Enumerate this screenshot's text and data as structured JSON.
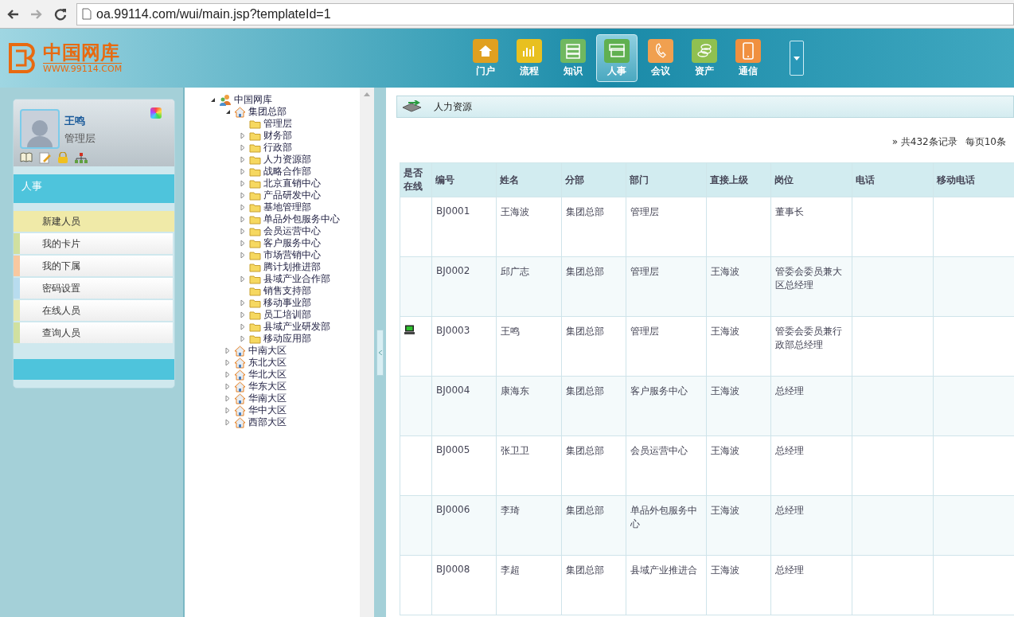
{
  "browser": {
    "url": "oa.99114.com/wui/main.jsp?templateId=1"
  },
  "header": {
    "logo_title": "中国网库",
    "logo_sub": "WWW.99114.COM",
    "nav": [
      {
        "label": "门户",
        "selected": false,
        "color": "#e0a020",
        "kind": "home"
      },
      {
        "label": "流程",
        "selected": false,
        "color": "#e8c020",
        "kind": "chart"
      },
      {
        "label": "知识",
        "selected": false,
        "color": "#70b860",
        "kind": "stack"
      },
      {
        "label": "人事",
        "selected": true,
        "color": "#60b050",
        "kind": "cards"
      },
      {
        "label": "会议",
        "selected": false,
        "color": "#f0a050",
        "kind": "phone"
      },
      {
        "label": "资产",
        "selected": false,
        "color": "#90c050",
        "kind": "coins"
      },
      {
        "label": "通信",
        "selected": false,
        "color": "#f09040",
        "kind": "mobile"
      }
    ]
  },
  "user": {
    "name": "王鸣",
    "role": "管理层"
  },
  "sidebar": {
    "title": "人事",
    "items": [
      {
        "label": "新建人员",
        "selected": true,
        "color": "#f0eaa8"
      },
      {
        "label": "我的卡片",
        "selected": false,
        "color": "#d0e0a0"
      },
      {
        "label": "我的下属",
        "selected": false,
        "color": "#f8c8a0"
      },
      {
        "label": "密码设置",
        "selected": false,
        "color": "#b8dcef"
      },
      {
        "label": "在线人员",
        "selected": false,
        "color": "#e4e8b0"
      },
      {
        "label": "查询人员",
        "selected": false,
        "color": "#d0e0a0"
      }
    ]
  },
  "tree": [
    {
      "label": "中国网库",
      "kind": "root",
      "expanded": true,
      "children": [
        {
          "label": "集团总部",
          "kind": "house",
          "expanded": true,
          "children": [
            {
              "label": "管理层",
              "kind": "folder",
              "has_children": false,
              "expanded": false
            },
            {
              "label": "财务部",
              "kind": "folder",
              "has_children": true,
              "expanded": false
            },
            {
              "label": "行政部",
              "kind": "folder",
              "has_children": true,
              "expanded": false
            },
            {
              "label": "人力资源部",
              "kind": "folder",
              "has_children": true,
              "expanded": false
            },
            {
              "label": "战略合作部",
              "kind": "folder",
              "has_children": true,
              "expanded": false
            },
            {
              "label": "北京直销中心",
              "kind": "folder",
              "has_children": true,
              "expanded": false
            },
            {
              "label": "产品研发中心",
              "kind": "folder",
              "has_children": true,
              "expanded": false
            },
            {
              "label": "基地管理部",
              "kind": "folder",
              "has_children": true,
              "expanded": false
            },
            {
              "label": "单品外包服务中心",
              "kind": "folder",
              "has_children": true,
              "expanded": false
            },
            {
              "label": "会员运营中心",
              "kind": "folder",
              "has_children": true,
              "expanded": false
            },
            {
              "label": "客户服务中心",
              "kind": "folder",
              "has_children": true,
              "expanded": false
            },
            {
              "label": "市场营销中心",
              "kind": "folder",
              "has_children": true,
              "expanded": false
            },
            {
              "label": "腾计划推进部",
              "kind": "folder",
              "has_children": false,
              "expanded": false
            },
            {
              "label": "县域产业合作部",
              "kind": "folder",
              "has_children": true,
              "expanded": false
            },
            {
              "label": "销售支持部",
              "kind": "folder",
              "has_children": false,
              "expanded": false
            },
            {
              "label": "移动事业部",
              "kind": "folder",
              "has_children": true,
              "expanded": false
            },
            {
              "label": "员工培训部",
              "kind": "folder",
              "has_children": true,
              "expanded": false
            },
            {
              "label": "县域产业研发部",
              "kind": "folder",
              "has_children": true,
              "expanded": false
            },
            {
              "label": "移动应用部",
              "kind": "folder",
              "has_children": true,
              "expanded": false
            }
          ]
        },
        {
          "label": "中南大区",
          "kind": "house",
          "has_children": true,
          "expanded": false
        },
        {
          "label": "东北大区",
          "kind": "house",
          "has_children": true,
          "expanded": false
        },
        {
          "label": "华北大区",
          "kind": "house",
          "has_children": true,
          "expanded": false
        },
        {
          "label": "华东大区",
          "kind": "house",
          "has_children": true,
          "expanded": false
        },
        {
          "label": "华南大区",
          "kind": "house",
          "has_children": true,
          "expanded": false
        },
        {
          "label": "华中大区",
          "kind": "house",
          "has_children": true,
          "expanded": false
        },
        {
          "label": "西部大区",
          "kind": "house",
          "has_children": true,
          "expanded": false
        }
      ]
    }
  ],
  "content": {
    "title": "人力资源",
    "pager": "» 共432条记录",
    "per_page": "每页10条",
    "table": {
      "columns": [
        "是否在线",
        "编号",
        "姓名",
        "分部",
        "部门",
        "直接上级",
        "岗位",
        "电话",
        "移动电话"
      ],
      "rows": [
        {
          "online": false,
          "id": "BJ0001",
          "name": "王海波",
          "branch": "集团总部",
          "dept": "管理层",
          "post": "董事长"
        },
        {
          "online": false,
          "id": "BJ0002",
          "name": "邱广志",
          "branch": "集团总部",
          "dept": "管理层",
          "manager": "王海波",
          "post": "管委会委员兼大区总经理"
        },
        {
          "online": true,
          "id": "BJ0003",
          "name": "王鸣",
          "branch": "集团总部",
          "dept": "管理层",
          "manager": "王海波",
          "post": "管委会委员兼行政部总经理"
        },
        {
          "online": false,
          "id": "BJ0004",
          "name": "康海东",
          "branch": "集团总部",
          "dept": "客户服务中心",
          "manager": "王海波",
          "post": "总经理"
        },
        {
          "online": false,
          "id": "BJ0005",
          "name": "张卫卫",
          "branch": "集团总部",
          "dept": "会员运营中心",
          "manager": "王海波",
          "post": "总经理"
        },
        {
          "online": false,
          "id": "BJ0006",
          "name": "李琦",
          "branch": "集团总部",
          "dept": "单品外包服务中心",
          "manager": "王海波",
          "post": "总经理"
        },
        {
          "online": false,
          "id": "BJ0008",
          "name": "李超",
          "branch": "集团总部",
          "dept": "县域产业推进合",
          "manager": "王海波",
          "post": "总经理"
        }
      ]
    }
  }
}
